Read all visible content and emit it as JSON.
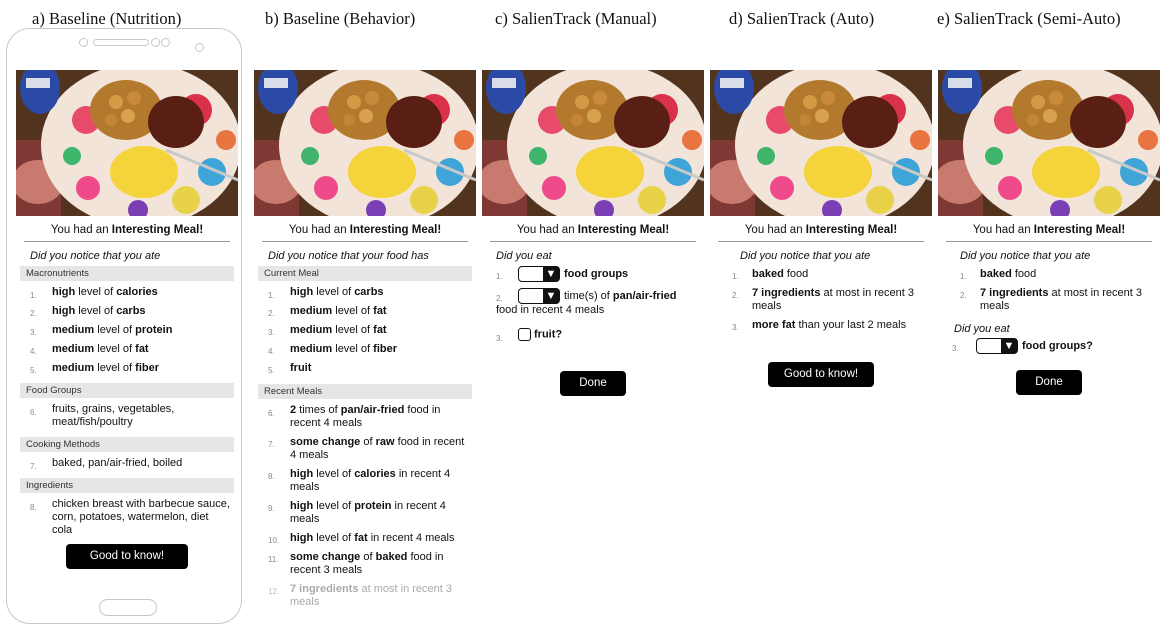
{
  "captions": {
    "a": "a) Baseline (Nutrition)",
    "b": "b) Baseline (Behavior)",
    "c": "c) SalienTrack (Manual)",
    "d": "d) SalienTrack (Auto)",
    "e": "e) SalienTrack (Semi-Auto)"
  },
  "common": {
    "had_prefix": "You had an ",
    "meal_label": "Interesting Meal!",
    "level_word": " level of ",
    "food_word": " food",
    "ingredients_suffix": " at most in recent 3 meals",
    "recent4": " in recent 4 meals"
  },
  "panel_a": {
    "prompt": "Did you notice that you ate",
    "sections": [
      "Macronutrients",
      "Food Groups",
      "Cooking Methods",
      "Ingredients"
    ],
    "nutrients": [
      {
        "num": "1.",
        "level": "high",
        "name": "calories"
      },
      {
        "num": "2.",
        "level": "high",
        "name": "carbs"
      },
      {
        "num": "3.",
        "level": "medium",
        "name": "protein"
      },
      {
        "num": "4.",
        "level": "medium",
        "name": "fat"
      },
      {
        "num": "5.",
        "level": "medium",
        "name": "fiber"
      }
    ],
    "food_groups": {
      "num": "6.",
      "text": "fruits, grains, vegetables, meat/fish/poultry"
    },
    "cooking": {
      "num": "7.",
      "text": "baked, pan/air-fried, boiled"
    },
    "ingredients": {
      "num": "8.",
      "text": "chicken breast with barbecue sauce, corn, potatoes, watermelon, diet cola"
    },
    "button": "Good to know!"
  },
  "panel_b": {
    "prompt": "Did you notice that your food has",
    "sections": [
      "Current Meal",
      "Recent Meals"
    ],
    "current": [
      {
        "num": "1.",
        "level": "high",
        "name": "carbs"
      },
      {
        "num": "2.",
        "level": "medium",
        "name": "fat"
      },
      {
        "num": "3.",
        "level": "medium",
        "name": "fat"
      },
      {
        "num": "4.",
        "level": "medium",
        "name": "fiber"
      },
      {
        "num": "5.",
        "name": "fruit"
      }
    ],
    "recent": {
      "i6": {
        "num": "6.",
        "bold": "2",
        "mid": " times of ",
        "bold2": "pan/air-fried",
        "rest": " food in recent 4 meals"
      },
      "i7": {
        "num": "7.",
        "bold": "some change",
        "mid": " of ",
        "bold2": "raw",
        "rest": " food in recent 4 meals"
      },
      "i8": {
        "num": "8.",
        "bold": "high",
        "mid": " level of ",
        "bold2": "calories",
        "rest": " in recent 4 meals"
      },
      "i9": {
        "num": "9.",
        "bold": "high",
        "mid": " level of ",
        "bold2": "protein",
        "rest": " in recent 4 meals"
      },
      "i10": {
        "num": "10.",
        "bold": "high",
        "mid": " level of ",
        "bold2": "fat",
        "rest": " in recent 4 meals"
      },
      "i11": {
        "num": "11.",
        "bold": "some change",
        "mid": " of ",
        "bold2": "baked",
        "rest": " food in recent 3 meals"
      },
      "i12": {
        "num": "12.",
        "bold": "7 ingredients",
        "rest": " at most in recent 3 meals"
      }
    }
  },
  "panel_c": {
    "prompt": "Did you eat",
    "i1": {
      "num": "1.",
      "text": "food groups"
    },
    "i2": {
      "num": "2.",
      "pre": "time(s) of ",
      "bold": "pan/air-fried",
      "rest": "food in recent 4 meals"
    },
    "i3": {
      "num": "3.",
      "text": "fruit?"
    },
    "button": "Done"
  },
  "panel_d": {
    "prompt": "Did you notice that you ate",
    "i1": {
      "num": "1.",
      "bold": "baked"
    },
    "i2": {
      "num": "2.",
      "bold": "7 ingredients"
    },
    "i3": {
      "num": "3.",
      "bold": "more fat",
      "rest": " than your last 2 meals"
    },
    "button": "Good to know!"
  },
  "panel_e": {
    "prompt": "Did you notice that you ate",
    "prompt2": "Did you eat",
    "i1": {
      "num": "1.",
      "bold": "baked"
    },
    "i2": {
      "num": "2.",
      "bold": "7 ingredients"
    },
    "i3": {
      "num": "3.",
      "text": "food groups?"
    },
    "button": "Done"
  }
}
